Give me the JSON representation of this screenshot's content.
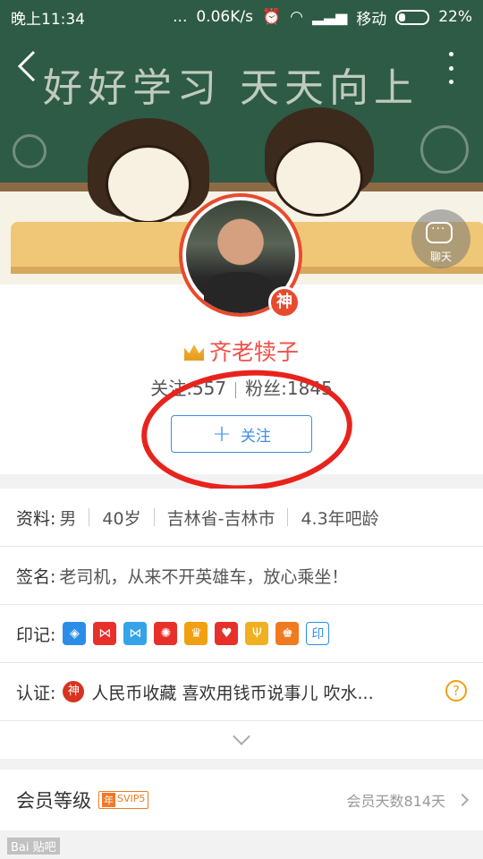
{
  "status_bar": {
    "time": "晚上11:34",
    "dots": "...",
    "speed": "0.06K/s",
    "carrier": "移动",
    "battery": "22%"
  },
  "header": {
    "chalk_text": "好好学习 天天向上",
    "chat_label": "聊天"
  },
  "profile": {
    "badge": "神",
    "name": "齐老犊子",
    "follow_label": "关注:",
    "follow_count": "557",
    "fans_label": "粉丝:",
    "fans_count": "1845",
    "follow_button": "关注"
  },
  "info": {
    "profile_label": "资料:",
    "gender": "男",
    "age": "40岁",
    "location": "吉林省-吉林市",
    "bar_age": "4.3年吧龄",
    "signature_label": "签名:",
    "signature": "老司机，从来不开英雄车，放心乘坐！",
    "marks_label": "印记:",
    "marks": [
      {
        "icon": "shield-icon",
        "color": "#2c8de8"
      },
      {
        "icon": "bow-icon",
        "color": "#e8302a"
      },
      {
        "icon": "bow-icon",
        "color": "#34a3e8"
      },
      {
        "icon": "flower-icon",
        "color": "#e8302a"
      },
      {
        "icon": "trophy-icon",
        "color": "#f0a010"
      },
      {
        "icon": "heart-icon",
        "color": "#e8302a"
      },
      {
        "icon": "psi-icon",
        "color": "#f0b020"
      },
      {
        "icon": "crown-icon",
        "color": "#f07a20"
      },
      {
        "icon": "seal-icon",
        "color": "#2c8de8",
        "text": "印"
      }
    ],
    "cert_label": "认证:",
    "cert_icon": "神",
    "cert_text": "人民币收藏  喜欢用钱币说事儿 吹水..."
  },
  "member": {
    "title": "会员等级",
    "level_prefix": "年",
    "level": "SVIP5",
    "days": "会员天数814天"
  },
  "watermark": "Bai 贴吧"
}
